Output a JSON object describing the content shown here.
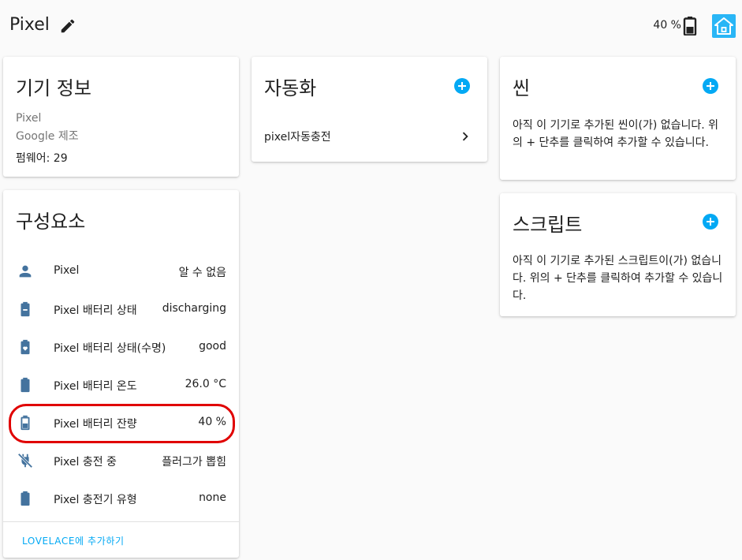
{
  "header": {
    "title": "Pixel",
    "battery_text": "40 %"
  },
  "colors": {
    "accent": "#03a9f4",
    "icon_blue": "#44739e",
    "highlight_red": "#e00000"
  },
  "device_info": {
    "title": "기기 정보",
    "model": "Pixel",
    "manufacturer": "Google 제조",
    "firmware": "펌웨어: 29"
  },
  "components": {
    "title": "구성요소",
    "entities": [
      {
        "name": "Pixel",
        "state": "알 수 없음",
        "icon": "account-icon"
      },
      {
        "name": "Pixel 배터리 상태",
        "state": "discharging",
        "icon": "battery-minus-icon"
      },
      {
        "name": "Pixel 배터리 상태(수명)",
        "state": "good",
        "icon": "battery-heart-icon"
      },
      {
        "name": "Pixel 배터리 온도",
        "state": "26.0 °C",
        "icon": "battery-icon"
      },
      {
        "name": "Pixel 배터리 잔량",
        "state": "40 %",
        "icon": "battery-40-icon"
      },
      {
        "name": "Pixel 충전 중",
        "state": "플러그가 뽑힘",
        "icon": "power-plug-off-icon"
      },
      {
        "name": "Pixel 충전기 유형",
        "state": "none",
        "icon": "battery-icon"
      }
    ],
    "add_to_lovelace": "LOVELACE에 추가하기"
  },
  "automation": {
    "title": "자동화",
    "items": [
      {
        "label": "pixel자동충전"
      }
    ]
  },
  "scene": {
    "title": "씬",
    "empty_text": "아직 이 기기로 추가된 씬이(가) 없습니다. 위의 + 단추를 클릭하여 추가할 수 있습니다."
  },
  "script": {
    "title": "스크립트",
    "empty_text": "아직 이 기기로 추가된 스크립트이(가) 없습니다. 위의 + 단추를 클릭하여 추가할 수 있습니다."
  }
}
